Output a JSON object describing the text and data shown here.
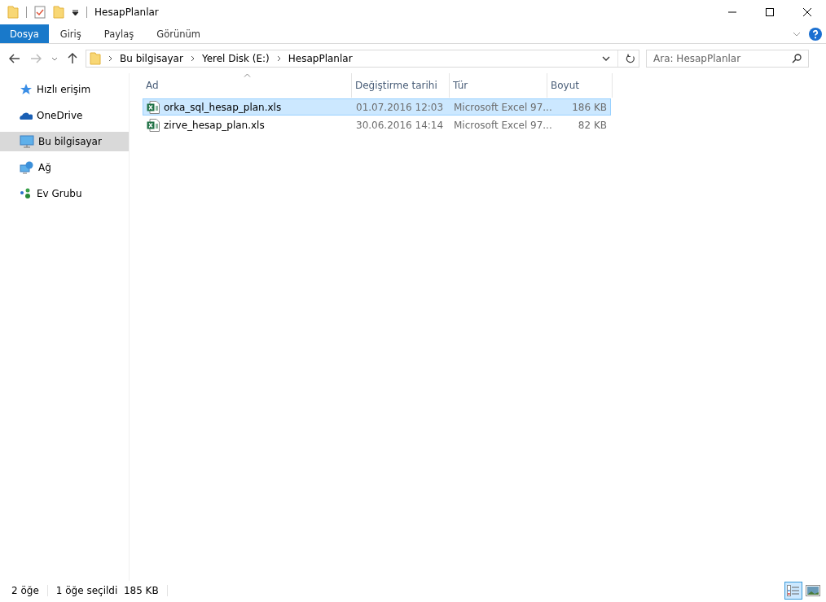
{
  "window": {
    "title": "HesapPlanlar"
  },
  "ribbon_tabs": [
    {
      "label": "Dosya",
      "selected": true
    },
    {
      "label": "Giriş",
      "selected": false
    },
    {
      "label": "Paylaş",
      "selected": false
    },
    {
      "label": "Görünüm",
      "selected": false
    }
  ],
  "address": {
    "breadcrumbs": [
      "Bu bilgisayar",
      "Yerel Disk (E:)",
      "HesapPlanlar"
    ]
  },
  "search": {
    "placeholder": "Ara: HesapPlanlar"
  },
  "sidebar": {
    "items": [
      {
        "label": "Hızlı erişim",
        "kind": "star",
        "selected": false
      },
      {
        "label": "OneDrive",
        "kind": "cloud",
        "selected": false
      },
      {
        "label": "Bu bilgisayar",
        "kind": "computer",
        "selected": true
      },
      {
        "label": "Ağ",
        "kind": "network",
        "selected": false
      },
      {
        "label": "Ev Grubu",
        "kind": "group",
        "selected": false
      }
    ]
  },
  "table": {
    "columns": [
      "Ad",
      "Değiştirme tarihi",
      "Tür",
      "Boyut"
    ],
    "rows": [
      {
        "name": "orka_sql_hesap_plan.xls",
        "date": "01.07.2016 12:03",
        "type": "Microsoft Excel 97...",
        "size": "186 KB",
        "selected": true
      },
      {
        "name": "zirve_hesap_plan.xls",
        "date": "30.06.2016 14:14",
        "type": "Microsoft Excel 97...",
        "size": "82 KB",
        "selected": false
      }
    ]
  },
  "status_bar": {
    "count": "2 öğe",
    "selection": "1 öğe seçildi  185 KB"
  },
  "views": [
    {
      "kind": "details",
      "selected": true
    },
    {
      "kind": "large",
      "selected": false
    }
  ]
}
